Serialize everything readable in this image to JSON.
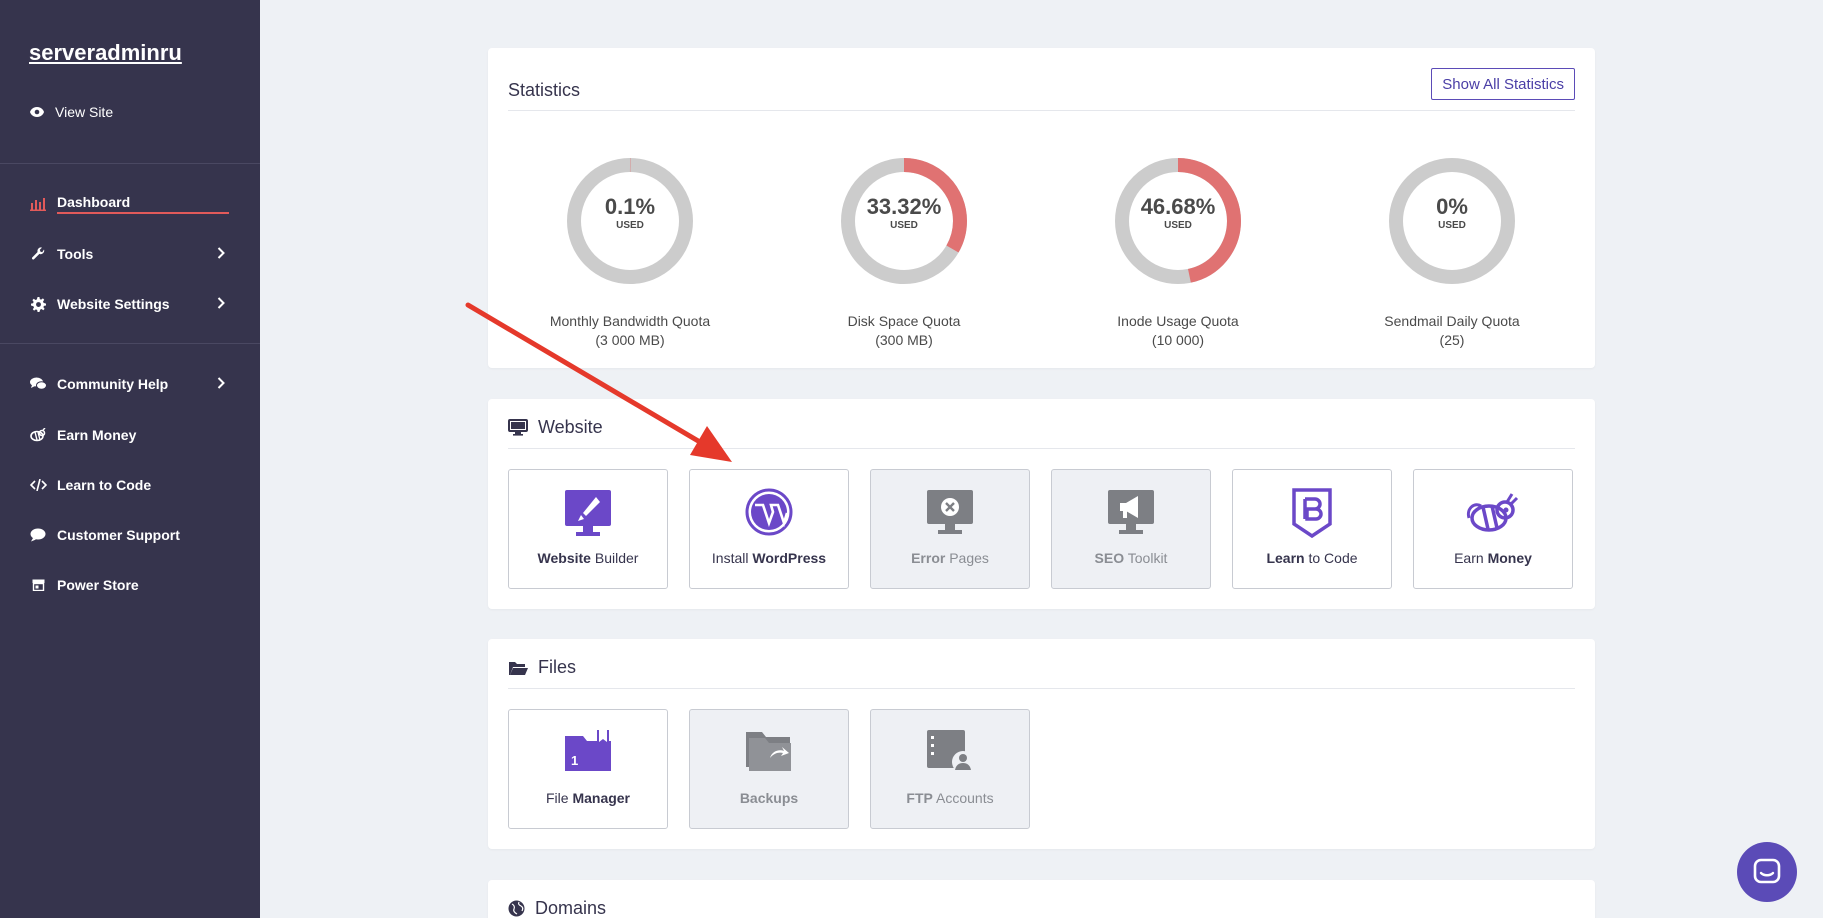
{
  "sidebar": {
    "brand": "serveradminru",
    "view_site": "View Site",
    "items": [
      {
        "label": "Dashboard",
        "icon": "bar-chart-icon"
      },
      {
        "label": "Tools",
        "icon": "wrench-icon"
      },
      {
        "label": "Website Settings",
        "icon": "gear-icon"
      },
      {
        "label": "Community Help",
        "icon": "chat-bubbles-icon"
      },
      {
        "label": "Earn Money",
        "icon": "bee-icon"
      },
      {
        "label": "Learn to Code",
        "icon": "code-icon"
      },
      {
        "label": "Customer Support",
        "icon": "speech-bubble-icon"
      },
      {
        "label": "Power Store",
        "icon": "store-icon"
      }
    ]
  },
  "statistics": {
    "title": "Statistics",
    "show_all": "Show All Statistics",
    "used_label": "USED",
    "gauges": [
      {
        "value_text": "0.1%",
        "fraction": 0.001,
        "label": "Monthly Bandwidth Quota",
        "sub": "(3 000 MB)"
      },
      {
        "value_text": "33.32%",
        "fraction": 0.3332,
        "label": "Disk Space Quota",
        "sub": "(300 MB)"
      },
      {
        "value_text": "46.68%",
        "fraction": 0.4668,
        "label": "Inode Usage Quota",
        "sub": "(10 000)"
      },
      {
        "value_text": "0%",
        "fraction": 0,
        "label": "Sendmail Daily Quota",
        "sub": "(25)"
      }
    ]
  },
  "website": {
    "title": "Website",
    "tiles": [
      {
        "bold": "Website",
        "rest": " Builder"
      },
      {
        "pre": "Install ",
        "bold": "WordPress"
      },
      {
        "bold": "Error",
        "rest": " Pages"
      },
      {
        "bold": "SEO",
        "rest": " Toolkit"
      },
      {
        "bold": "Learn",
        "rest": " to Code"
      },
      {
        "pre": "Earn ",
        "bold": "Money"
      }
    ]
  },
  "files": {
    "title": "Files",
    "tiles": [
      {
        "pre": "File ",
        "bold": "Manager"
      },
      {
        "bold": "Backups"
      },
      {
        "bold": "FTP",
        "rest": " Accounts"
      }
    ]
  },
  "domains": {
    "title": "Domains"
  },
  "colors": {
    "sidebar_bg": "#36344d",
    "accent": "#5b4bb7",
    "gauge_used": "#e07272",
    "gauge_track": "#cccccc",
    "active_underline": "#e25a5a"
  }
}
